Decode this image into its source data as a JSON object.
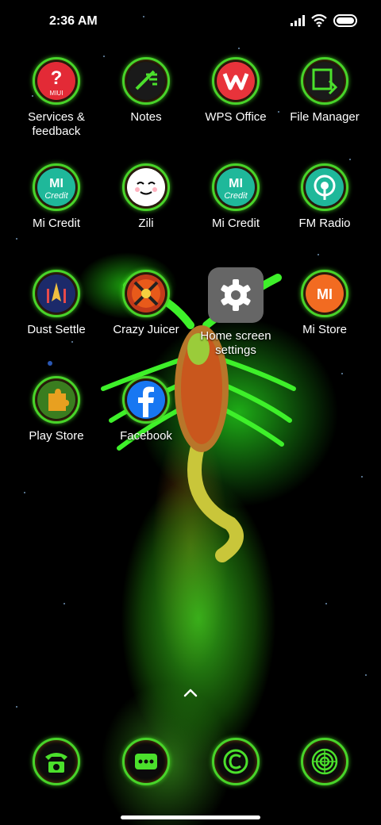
{
  "status_bar": {
    "time": "2:36 AM",
    "icons": [
      "signal-icon",
      "wifi-icon",
      "battery-icon"
    ]
  },
  "apps": [
    {
      "label": "Services & feedback",
      "icon": "help-icon",
      "color": "#e32a36",
      "badge": "MIUI"
    },
    {
      "label": "Notes",
      "icon": "notes-icon",
      "color": "#2b2b2b"
    },
    {
      "label": "WPS Office",
      "icon": "wps-icon",
      "color": "#e8333b"
    },
    {
      "label": "File Manager",
      "icon": "file-manager-icon",
      "color": "#2b2b2b"
    },
    {
      "label": "Mi Credit",
      "icon": "mi-credit-icon",
      "color": "#1fb89a",
      "badge": "MI"
    },
    {
      "label": "Zili",
      "icon": "zili-icon",
      "color": "#ffffff"
    },
    {
      "label": "Mi Credit",
      "icon": "mi-credit-icon",
      "color": "#1fb89a",
      "badge": "MI"
    },
    {
      "label": "FM Radio",
      "icon": "fm-radio-icon",
      "color": "#1fb89a"
    },
    {
      "label": "Dust Settle",
      "icon": "dust-settle-icon",
      "color": "#1c2a6a"
    },
    {
      "label": "Crazy Juicer",
      "icon": "crazy-juicer-icon",
      "color": "#c23a1a"
    },
    {
      "label": "Home screen settings",
      "icon": "settings-gear-icon",
      "color": "#666666"
    },
    {
      "label": "Mi Store",
      "icon": "mi-store-icon",
      "color": "#f26b21",
      "badge": "MI"
    },
    {
      "label": "Play Store",
      "icon": "play-store-icon",
      "color": "#3a7d1f"
    },
    {
      "label": "Facebook",
      "icon": "facebook-icon",
      "color": "#1877f2"
    }
  ],
  "dock": [
    {
      "icon": "phone-icon"
    },
    {
      "icon": "messages-icon"
    },
    {
      "icon": "browser-icon"
    },
    {
      "icon": "camera-icon"
    }
  ],
  "theme": {
    "ring_color": "#48d42a",
    "wallpaper_glow": "#3cdc1e"
  }
}
